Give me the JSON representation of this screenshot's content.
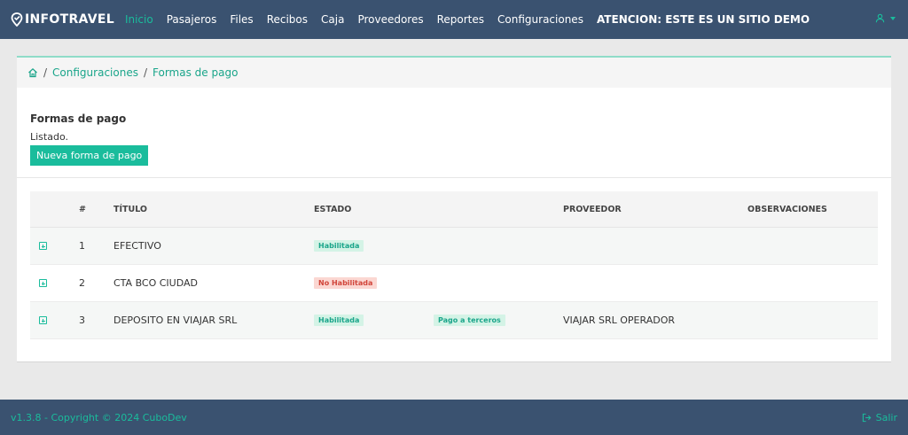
{
  "brand": {
    "name": "INFOTRAVEL"
  },
  "nav": {
    "items": [
      {
        "label": "Inicio",
        "active": true
      },
      {
        "label": "Pasajeros"
      },
      {
        "label": "Files"
      },
      {
        "label": "Recibos"
      },
      {
        "label": "Caja"
      },
      {
        "label": "Proveedores"
      },
      {
        "label": "Reportes"
      },
      {
        "label": "Configuraciones"
      }
    ],
    "demo_notice": "ATENCION: ESTE ES UN SITIO DEMO"
  },
  "breadcrumb": {
    "items": [
      "Configuraciones",
      "Formas de pago"
    ],
    "separator": "/"
  },
  "card": {
    "title": "Formas de pago",
    "subtitle": "Listado.",
    "new_button": "Nueva forma de pago"
  },
  "table": {
    "headers": {
      "num": "#",
      "titulo": "TÍTULO",
      "estado": "ESTADO",
      "proveedor": "PROVEEDOR",
      "observaciones": "OBSERVACIONES"
    },
    "rows": [
      {
        "num": "1",
        "titulo": "EFECTIVO",
        "estado": "Habilitada",
        "estado_type": "ok",
        "tag": "",
        "proveedor": "",
        "observaciones": ""
      },
      {
        "num": "2",
        "titulo": "CTA BCO CIUDAD",
        "estado": "No Habilitada",
        "estado_type": "no",
        "tag": "",
        "proveedor": "",
        "observaciones": ""
      },
      {
        "num": "3",
        "titulo": "DEPOSITO EN VIAJAR SRL",
        "estado": "Habilitada",
        "estado_type": "ok",
        "tag": "Pago a terceros",
        "proveedor": "VIAJAR SRL OPERADOR",
        "observaciones": ""
      }
    ]
  },
  "footer": {
    "copyright": "v1.3.8 - Copyright © 2024 CuboDev",
    "logout": "Salir"
  },
  "colors": {
    "navbar": "#3a5270",
    "accent": "#1abc9c",
    "danger": "#d1453a"
  }
}
